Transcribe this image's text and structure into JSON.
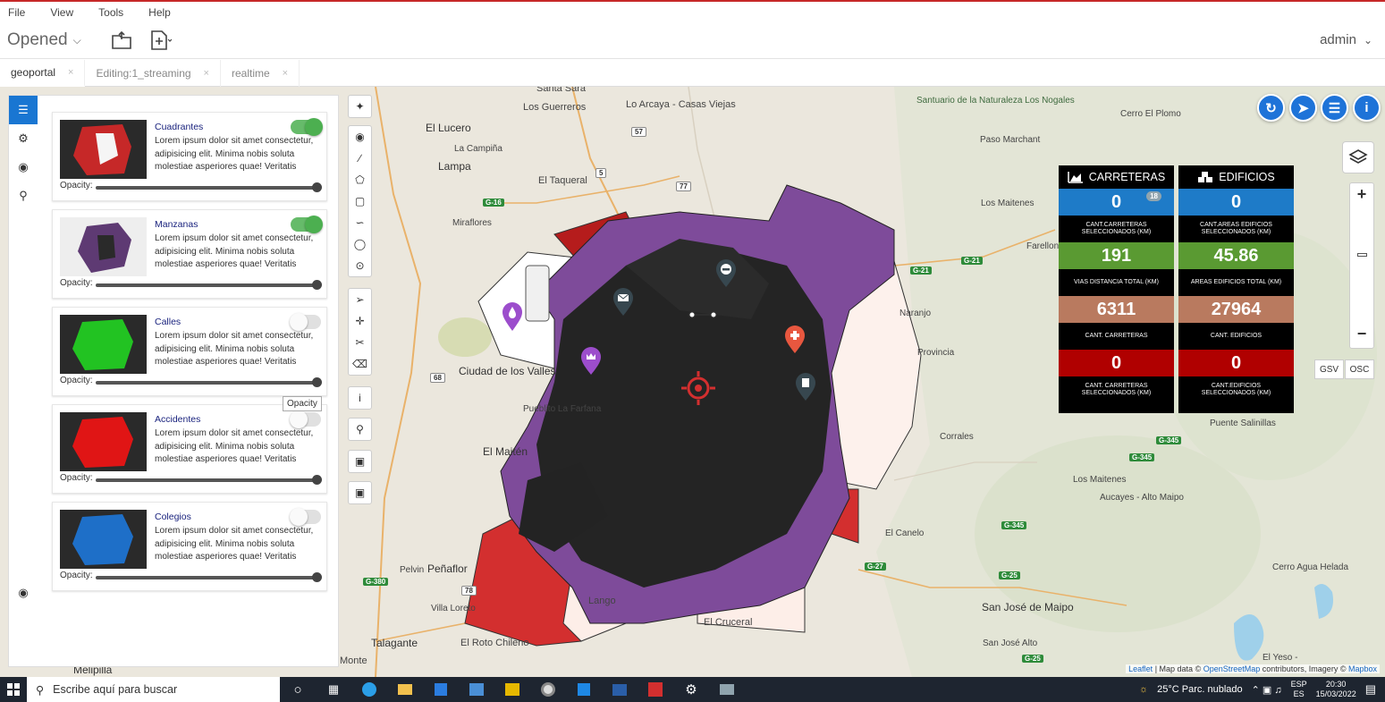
{
  "menu": [
    "File",
    "View",
    "Tools",
    "Help"
  ],
  "toolbar": {
    "opened_label": "Opened",
    "user": "admin"
  },
  "tabs": [
    {
      "label": "geoportal",
      "active": true
    },
    {
      "label": "Editing:1_streaming",
      "active": false
    },
    {
      "label": "realtime",
      "active": false
    }
  ],
  "layers": [
    {
      "title": "Cuadrantes",
      "desc": "Lorem ipsum dolor sit amet consectetur, adipisicing elit. Minima nobis soluta molestiae asperiores quae! Veritatis",
      "enabled": true,
      "opacity_label": "Opacity:",
      "opacity": 1.0,
      "thumb_color": "#c62828"
    },
    {
      "title": "Manzanas",
      "desc": "Lorem ipsum dolor sit amet consectetur, adipisicing elit. Minima nobis soluta molestiae asperiores quae! Veritatis",
      "enabled": true,
      "opacity_label": "Opacity:",
      "opacity": 1.0,
      "thumb_color": "#6a3d8a"
    },
    {
      "title": "Calles",
      "desc": "Lorem ipsum dolor sit amet consectetur, adipisicing elit. Minima nobis soluta molestiae asperiores quae! Veritatis",
      "enabled": false,
      "opacity_label": "Opacity:",
      "opacity": 1.0,
      "thumb_color": "#22c322"
    },
    {
      "title": "Accidentes",
      "desc": "Lorem ipsum dolor sit amet consectetur, adipisicing elit. Minima nobis soluta molestiae asperiores quae! Veritatis",
      "enabled": false,
      "opacity_label": "Opacity:",
      "opacity": 1.0,
      "thumb_color": "#e01515"
    },
    {
      "title": "Colegios",
      "desc": "Lorem ipsum dolor sit amet consectetur, adipisicing elit. Minima nobis soluta molestiae asperiores quae! Veritatis",
      "enabled": false,
      "opacity_label": "Opacity:",
      "opacity": 1.0,
      "thumb_color": "#1e6fc8"
    }
  ],
  "tooltip": "Opacity",
  "map_labels": [
    "Santa Sara",
    "Los Guerreros",
    "Lo Arcaya - Casas Viejas",
    "El Lucero",
    "La Campiña",
    "Lampa",
    "El Taqueral",
    "Miraflores",
    "Ciudad de los Valles",
    "Pueblito La Farfana",
    "El Maitén",
    "Pelvin",
    "Peñaflor",
    "Villa Loreto",
    "Talagante",
    "El Roto Chileno",
    "El Cruceral",
    "Monte",
    "Melipilla",
    "Santuario de la Naturaleza Los Nogales",
    "Cerro El Plomo",
    "Paso Marchant",
    "Los Maitenes",
    "Farellones",
    "Naranjo",
    "Corrales",
    "El Canelo",
    "Puente Salinillas",
    "Los Maitenes",
    "Aucayes - Alto Maipo",
    "San José de Maipo",
    "San José Alto",
    "Cerro Agua Helada",
    "El Yeso -",
    "Provincia",
    "Lango"
  ],
  "stats": {
    "carreteras": {
      "title": "CARRETERAS",
      "rows": [
        {
          "value": "0",
          "caption": "CANT.CARRETERAS SELECCIONADOS (KM)",
          "color": "#1e7bc8",
          "badge": "18"
        },
        {
          "value": "191",
          "caption": "VIAS DISTANCIA TOTAL (KM)",
          "color": "#5a9a32"
        },
        {
          "value": "6311",
          "caption": "CANT. CARRETERAS",
          "color": "#b97a5f"
        },
        {
          "value": "0",
          "caption": "CANT. CARRETERAS SELECCIONADOS (KM)",
          "color": "#b00000"
        }
      ]
    },
    "edificios": {
      "title": "EDIFICIOS",
      "rows": [
        {
          "value": "0",
          "caption": "CANT.AREAS EDIFICIOS SELECCIONADOS (KM)",
          "color": "#1e7bc8"
        },
        {
          "value": "45.86",
          "caption": "AREAS EDIFICIOS TOTAL (KM)",
          "color": "#5a9a32"
        },
        {
          "value": "27964",
          "caption": "CANT. EDIFICIOS",
          "color": "#b97a5f"
        },
        {
          "value": "0",
          "caption": "CANT.EDIFICIOS SELECCIONADOS (KM)",
          "color": "#b00000"
        }
      ]
    }
  },
  "map_buttons": {
    "gsv": "GSV",
    "osc": "OSC",
    "zoom_in": "+",
    "zoom_out": "−"
  },
  "attribution": {
    "leaflet": "Leaflet",
    "text1": "| Map data ©",
    "osm": "OpenStreetMap",
    "text2": "contributors, Imagery ©",
    "mapbox": "Mapbox"
  },
  "taskbar": {
    "search_placeholder": "Escribe aquí para buscar",
    "weather": "25°C  Parc. nublado",
    "lang": "ESP",
    "lang2": "ES",
    "time": "20:30",
    "date": "15/03/2022"
  }
}
